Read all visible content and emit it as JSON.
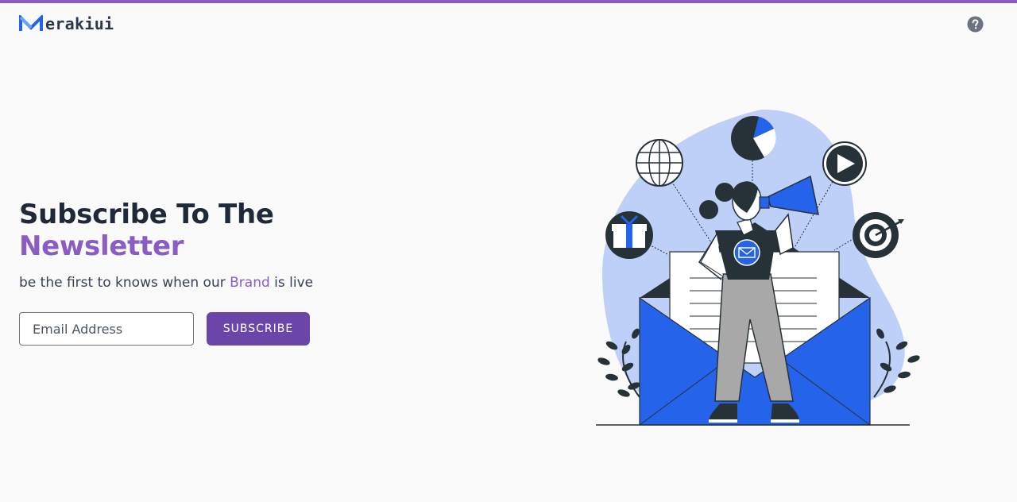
{
  "app": {
    "logo_text": "erakiui"
  },
  "hero": {
    "title_line1": "Subscribe To The",
    "title_line2": "Newsletter",
    "subtitle_prefix": "be the first to knows when our ",
    "subtitle_brand": "Brand",
    "subtitle_suffix": " is live"
  },
  "form": {
    "email_placeholder": "Email Address",
    "email_value": "",
    "subscribe_label": "SUBSCRIBE"
  },
  "icons": {
    "logo": "merakiui-logo-icon",
    "help": "question-circle-icon"
  },
  "colors": {
    "accent": "#8b5cc4",
    "button": "#6b46a8",
    "illustration_blue": "#2563eb",
    "illustration_light_blue": "#bcd0fb",
    "dark": "#263238"
  }
}
